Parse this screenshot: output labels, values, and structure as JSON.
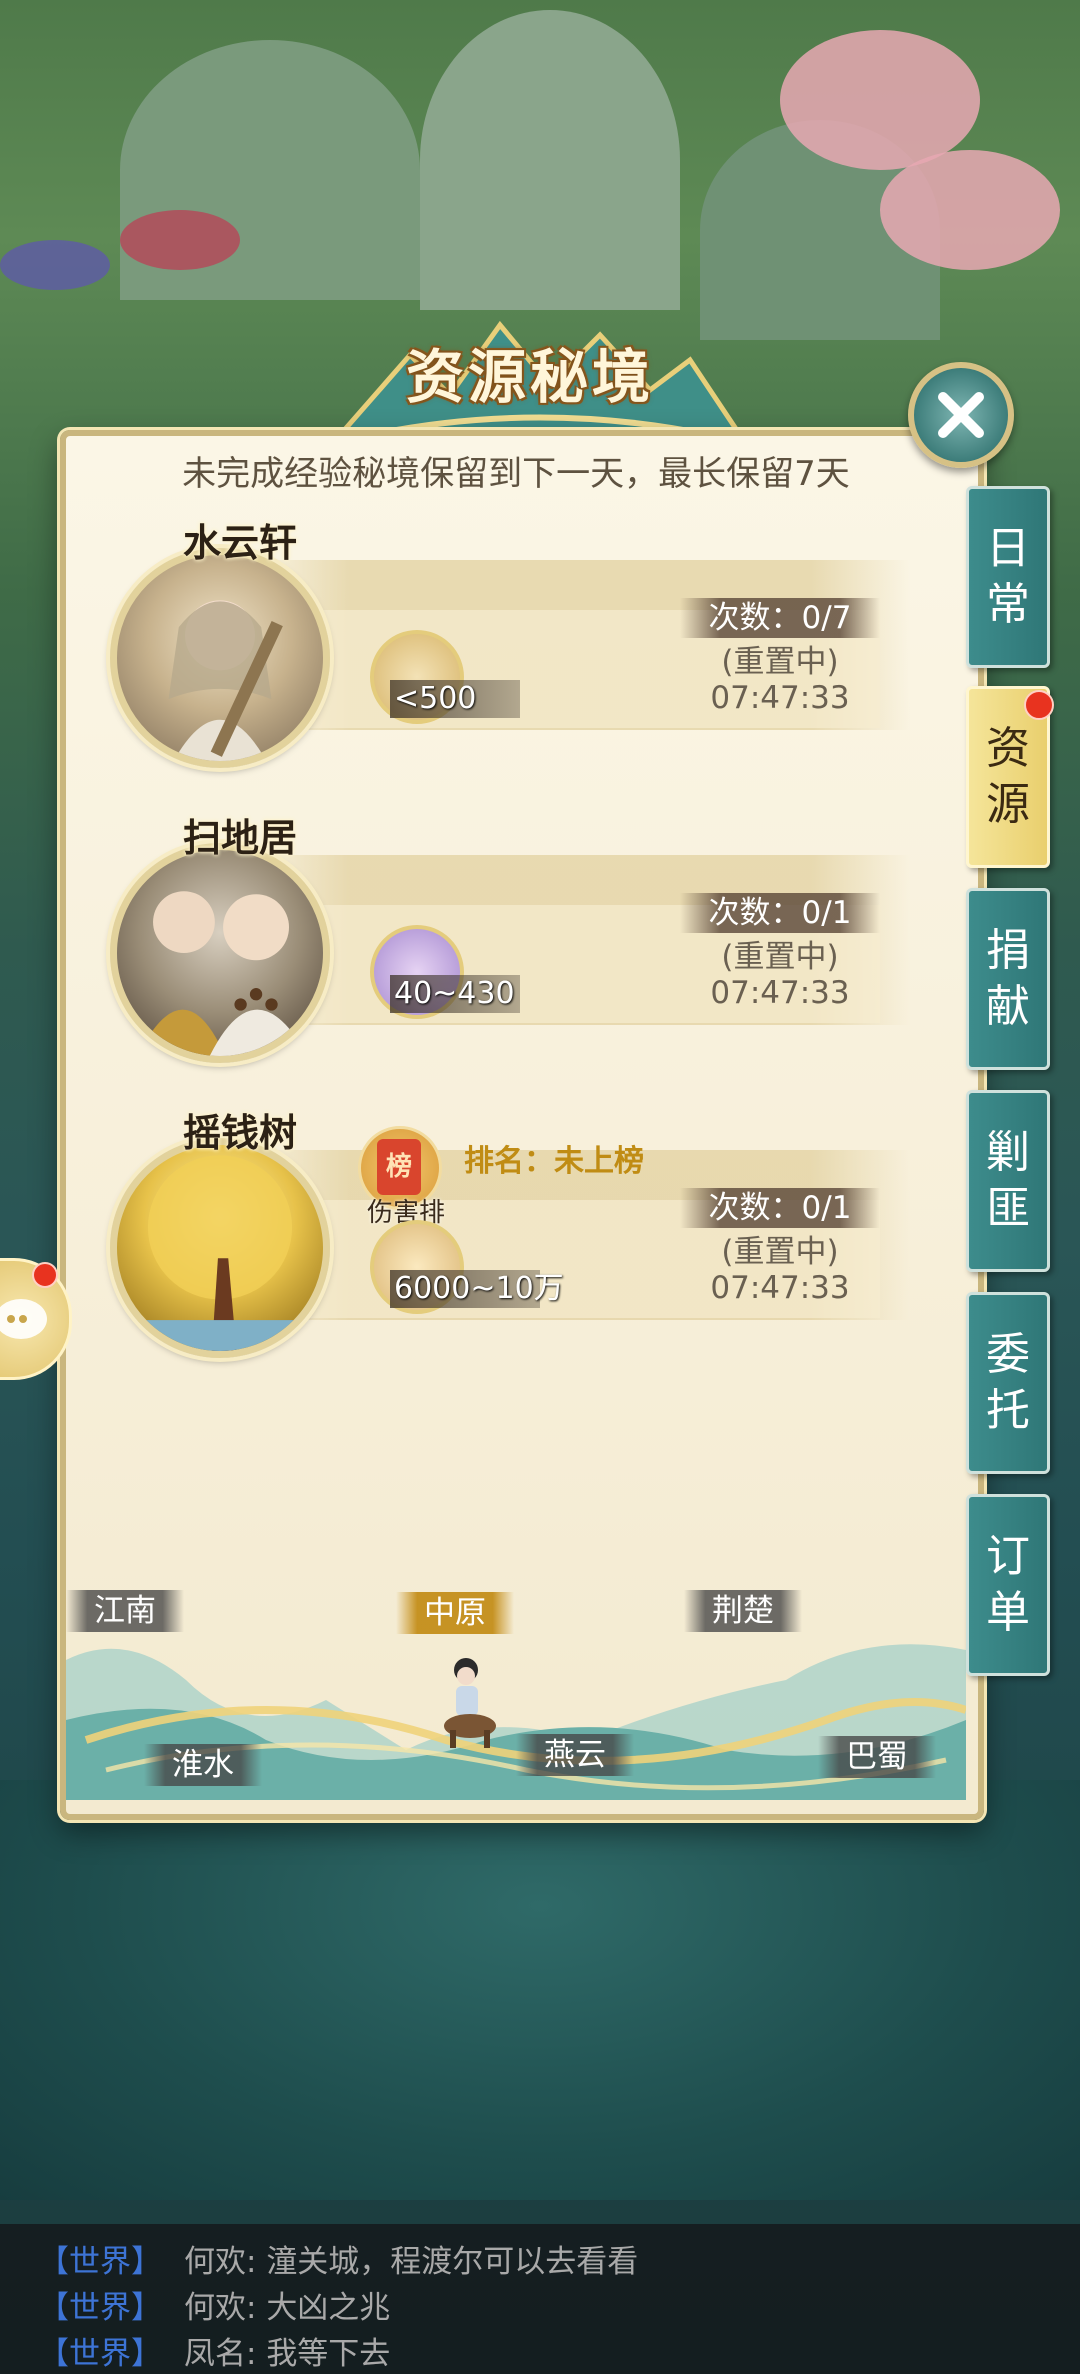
{
  "title": "资源秘境",
  "notice": "未完成经验秘境保留到下一天，最长保留7天",
  "entries": [
    {
      "name": "水云轩",
      "reward_icon": "scroll-icon",
      "reward": "<500",
      "count": "次数：0/7",
      "status": "(重置中)",
      "timer": "07:47:33"
    },
    {
      "name": "扫地居",
      "reward_icon": "sword-icon",
      "reward": "40~430",
      "count": "次数：0/1",
      "status": "(重置中)",
      "timer": "07:47:33"
    },
    {
      "name": "摇钱树",
      "reward_icon": "coin-pile-icon",
      "reward": "6000~10万",
      "count": "次数：0/1",
      "status": "(重置中)",
      "timer": "07:47:33",
      "rank_badge": "榜",
      "rank_caption": "伤害排名",
      "rank_text": "排名：未上榜"
    }
  ],
  "side_tabs": [
    {
      "label": [
        "日",
        "常"
      ],
      "active": false,
      "badge": false
    },
    {
      "label": [
        "资",
        "源"
      ],
      "active": true,
      "badge": true
    },
    {
      "label": [
        "捐",
        "献"
      ],
      "active": false,
      "badge": false
    },
    {
      "label": [
        "剿",
        "匪"
      ],
      "active": false,
      "badge": false
    },
    {
      "label": [
        "委",
        "托"
      ],
      "active": false,
      "badge": false
    },
    {
      "label": [
        "订",
        "单"
      ],
      "active": false,
      "badge": false
    }
  ],
  "regions": [
    {
      "name": "江南",
      "active": false
    },
    {
      "name": "中原",
      "active": true
    },
    {
      "name": "荆楚",
      "active": false
    },
    {
      "name": "淮水",
      "active": false
    },
    {
      "name": "燕云",
      "active": false
    },
    {
      "name": "巴蜀",
      "active": false
    }
  ],
  "chat": [
    {
      "channel": "【世界】",
      "sender": "何欢",
      "message": "潼关城，程渡尔可以去看看"
    },
    {
      "channel": "【世界】",
      "sender": "何欢",
      "message": "大凶之兆"
    },
    {
      "channel": "【世界】",
      "sender": "凤名",
      "message": "我等下去"
    }
  ],
  "colors": {
    "accent_teal": "#2f7777",
    "active_tab": "#f5e59a",
    "rank_gold": "#c08c14",
    "chat_channel": "#3d74d6",
    "badge_red": "#e8331f"
  }
}
